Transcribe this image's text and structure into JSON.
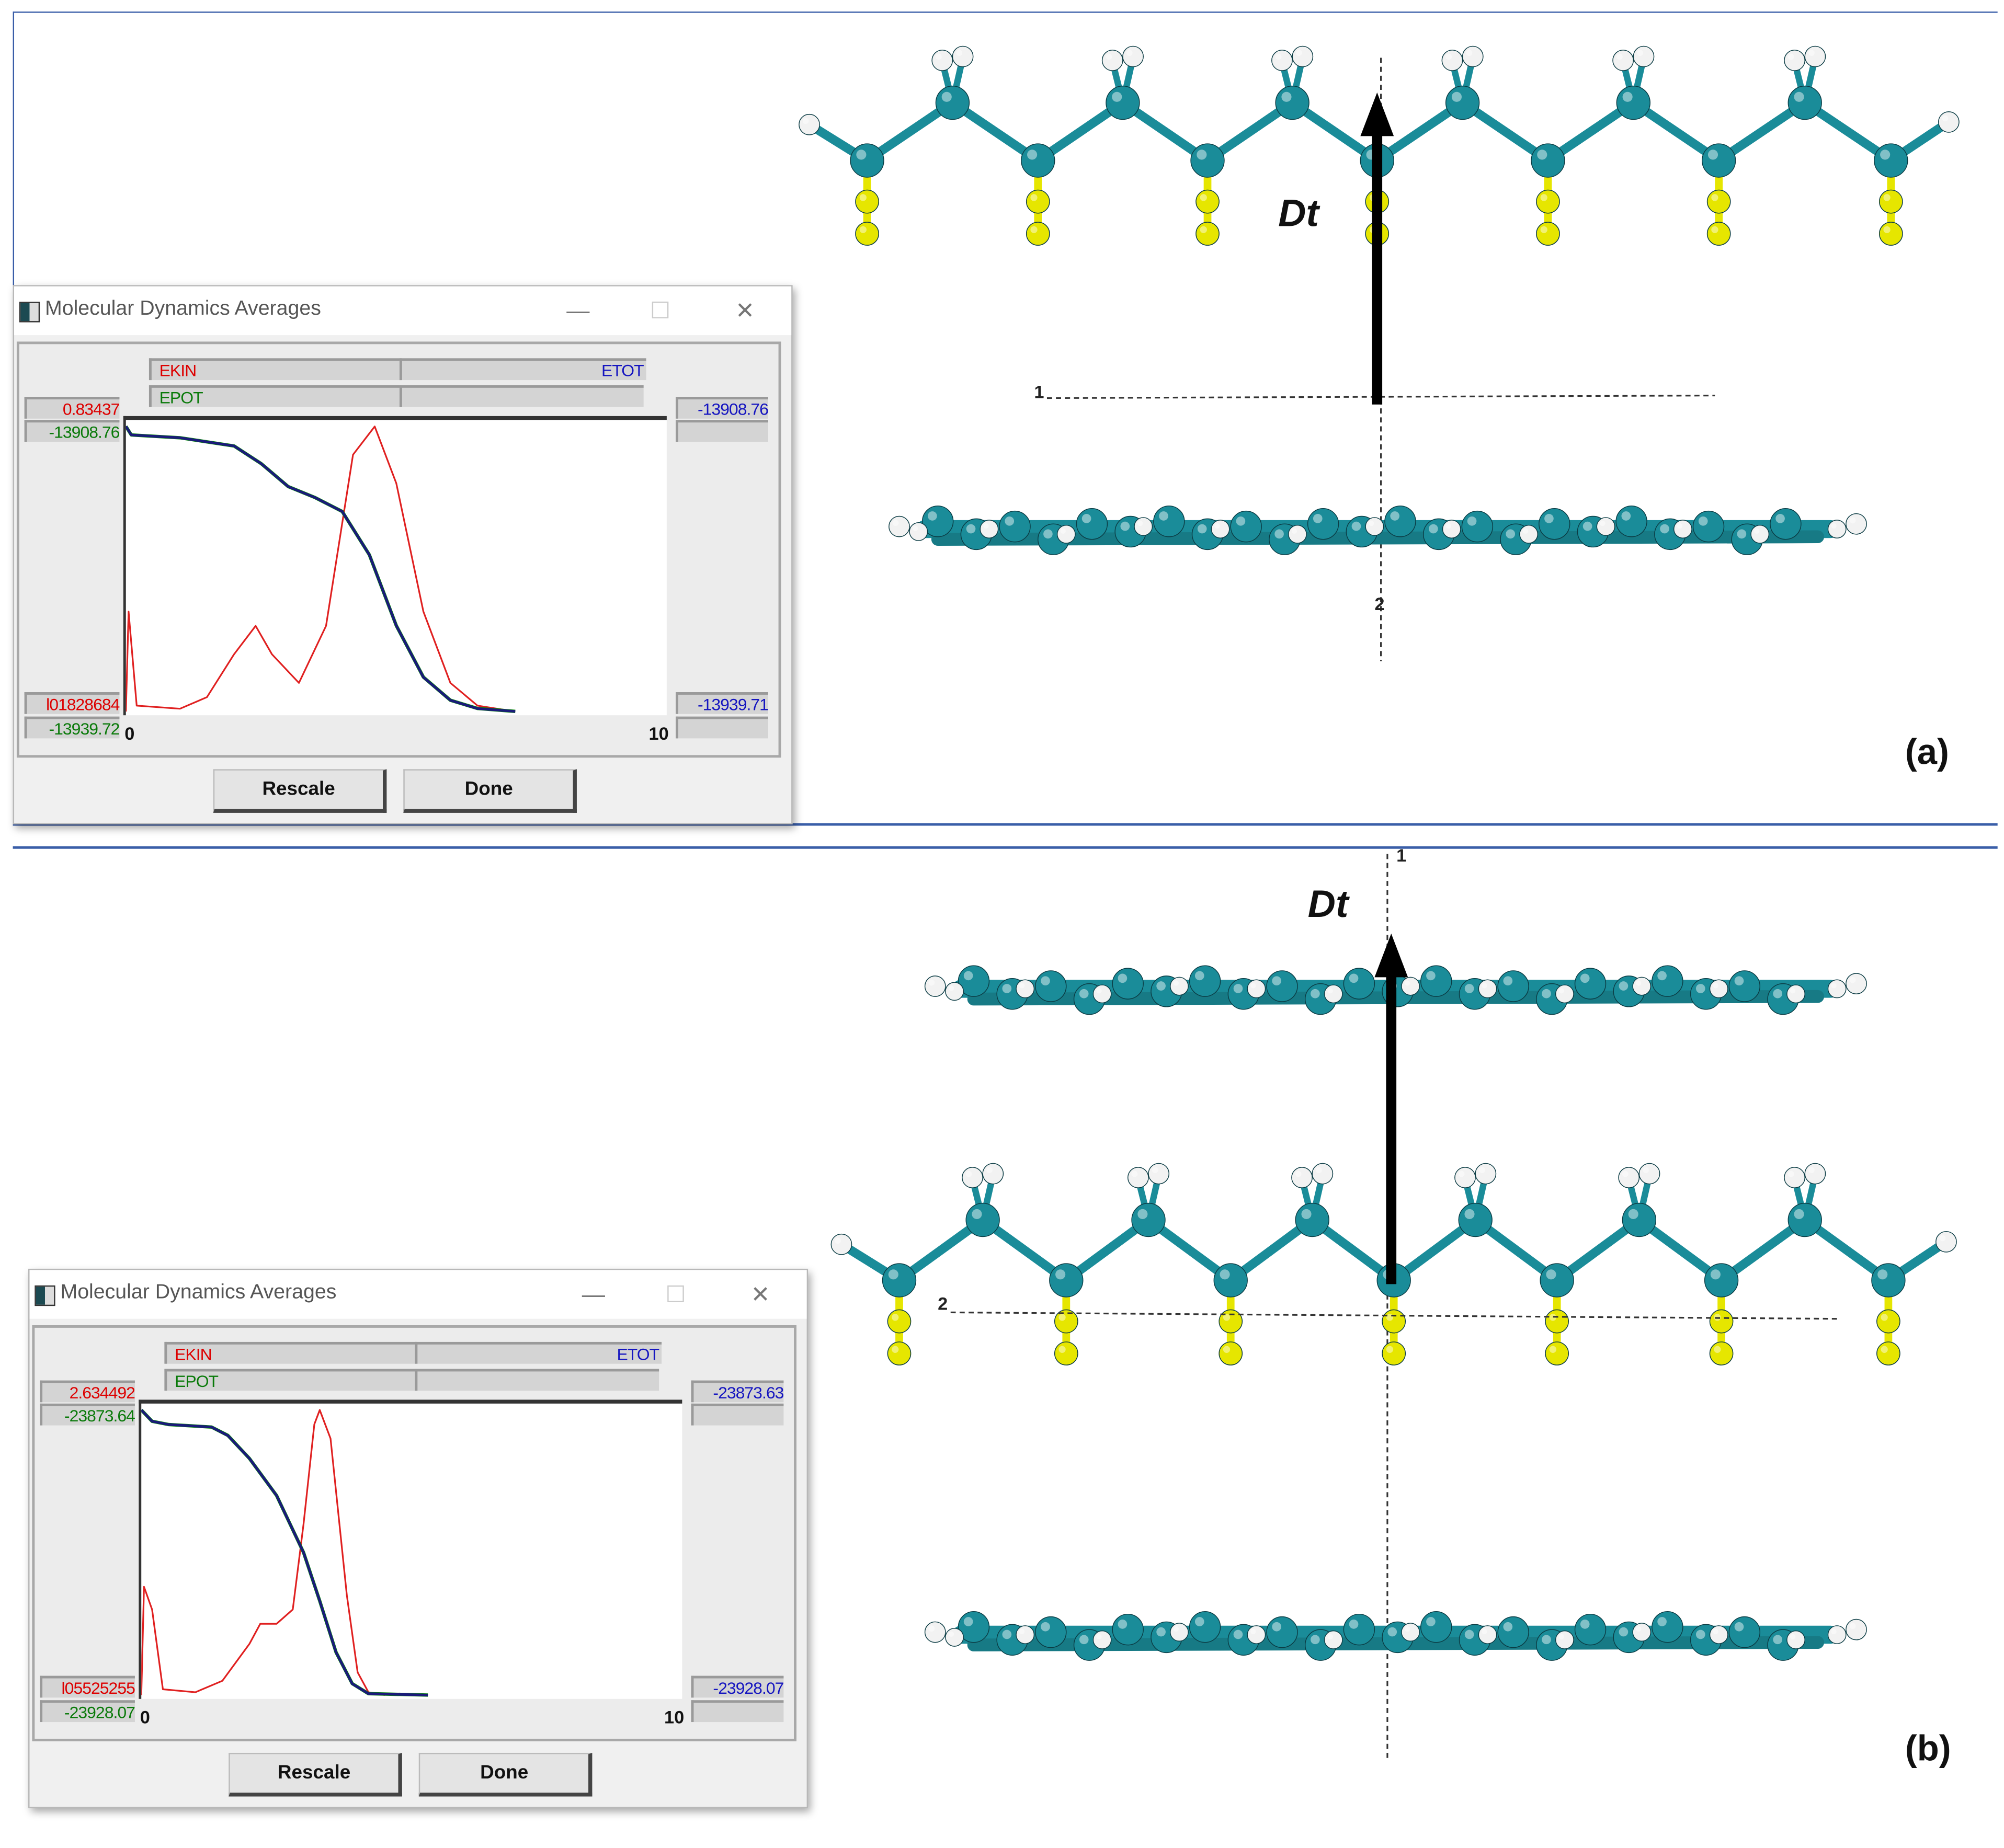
{
  "panels": [
    {
      "label": "(a)",
      "dt_label": "Dt",
      "axis_point_1": "1",
      "axis_point_2": "2",
      "dialog": {
        "title": "Molecular Dynamics Averages",
        "minimize": "—",
        "maximize": "☐",
        "close": "✕",
        "legend": {
          "ekin": "EKIN",
          "epot": "EPOT",
          "etot": "ETOT"
        },
        "left_top_red": "0.83437",
        "left_top_green": "-13908.76",
        "left_bottom_red": "l01828684",
        "left_bottom_green": "-13939.72",
        "right_top_blue": "-13908.76",
        "right_bottom_blue": "-13939.71",
        "x_min": "0",
        "x_max": "10",
        "rescale": "Rescale",
        "done": "Done"
      }
    },
    {
      "label": "(b)",
      "dt_label": "Dt",
      "axis_point_1": "1",
      "axis_point_2": "2",
      "dialog": {
        "title": "Molecular Dynamics Averages",
        "minimize": "—",
        "maximize": "☐",
        "close": "✕",
        "legend": {
          "ekin": "EKIN",
          "epot": "EPOT",
          "etot": "ETOT"
        },
        "left_top_red": "2.634492",
        "left_top_green": "-23873.64",
        "left_bottom_red": "l05525255",
        "left_bottom_green": "-23928.07",
        "right_top_blue": "-23873.63",
        "right_bottom_blue": "-23928.07",
        "x_min": "0",
        "x_max": "10",
        "rescale": "Rescale",
        "done": "Done"
      }
    }
  ],
  "colors": {
    "ekin": "#e02020",
    "epot": "#0a8a0a",
    "etot": "#1a1a7a",
    "carbon": "#1a8c99",
    "hydrogen": "#f2f2f2",
    "sulfur": "#e6e600",
    "frame": "#3a5ea8"
  },
  "chart_data": [
    {
      "type": "line",
      "title": "Molecular Dynamics Averages (a)",
      "xlim": [
        0,
        10
      ],
      "series": [
        {
          "name": "EKIN",
          "ylim": [
            0.01828684,
            0.83437
          ],
          "x": [
            0,
            0.05,
            0.2,
            1,
            1.5,
            2,
            2.4,
            2.7,
            3.2,
            3.7,
            4.2,
            4.6,
            5,
            5.5,
            6,
            6.5,
            7.2
          ],
          "y": [
            0.018,
            0.304,
            0.035,
            0.026,
            0.059,
            0.182,
            0.263,
            0.182,
            0.1,
            0.263,
            0.753,
            0.834,
            0.671,
            0.304,
            0.1,
            0.035,
            0.018
          ]
        },
        {
          "name": "EPOT",
          "ylim": [
            -13939.72,
            -13908.76
          ],
          "x": [
            0,
            0.1,
            1,
            2,
            2.5,
            3,
            3.5,
            4,
            4.5,
            5,
            5.5,
            6,
            6.5,
            7.2
          ],
          "y": [
            -13908.76,
            -13909.7,
            -13910.0,
            -13910.9,
            -13912.8,
            -13915.3,
            -13916.5,
            -13918.0,
            -13922.7,
            -13930.4,
            -13936.0,
            -13938.5,
            -13939.4,
            -13939.72
          ]
        },
        {
          "name": "ETOT",
          "ylim": [
            -13939.71,
            -13908.76
          ],
          "x": [
            0,
            0.1,
            1,
            2,
            2.5,
            3,
            3.5,
            4,
            4.5,
            5,
            5.5,
            6,
            6.5,
            7.2
          ],
          "y": [
            -13908.76,
            -13909.7,
            -13910.0,
            -13910.9,
            -13912.8,
            -13915.3,
            -13916.5,
            -13918.0,
            -13922.7,
            -13930.4,
            -13936.0,
            -13938.5,
            -13939.4,
            -13939.71
          ]
        }
      ]
    },
    {
      "type": "line",
      "title": "Molecular Dynamics Averages (b)",
      "xlim": [
        0,
        10
      ],
      "series": [
        {
          "name": "EKIN",
          "ylim": [
            0.05525255,
            2.634492
          ],
          "x": [
            0,
            0.05,
            0.2,
            0.4,
            1,
            1.5,
            2,
            2.2,
            2.5,
            2.8,
            3,
            3.2,
            3.3,
            3.5,
            3.8,
            4,
            4.2,
            4.5
          ],
          "y": [
            0.055,
            1.035,
            0.829,
            0.107,
            0.081,
            0.184,
            0.519,
            0.7,
            0.7,
            0.829,
            1.603,
            2.505,
            2.634,
            2.377,
            0.958,
            0.261,
            0.081,
            0.055
          ]
        },
        {
          "name": "EPOT",
          "ylim": [
            -23928.07,
            -23873.64
          ],
          "x": [
            0,
            0.2,
            0.5,
            1.3,
            1.6,
            2,
            2.5,
            3,
            3.3,
            3.6,
            3.9,
            4.2,
            5.3
          ],
          "y": [
            -23873.64,
            -23875.8,
            -23876.4,
            -23876.9,
            -23878.5,
            -23882.9,
            -23889.96,
            -23900.85,
            -23910.1,
            -23919.9,
            -23925.9,
            -23927.8,
            -23928.07
          ]
        },
        {
          "name": "ETOT",
          "ylim": [
            -23928.07,
            -23873.63
          ],
          "x": [
            0,
            0.2,
            0.5,
            1.3,
            1.6,
            2,
            2.5,
            3,
            3.3,
            3.6,
            3.9,
            4.2,
            5.3
          ],
          "y": [
            -23873.63,
            -23875.8,
            -23876.4,
            -23876.9,
            -23878.5,
            -23882.9,
            -23889.96,
            -23900.85,
            -23910.1,
            -23919.9,
            -23925.9,
            -23927.8,
            -23928.07
          ]
        }
      ]
    }
  ]
}
